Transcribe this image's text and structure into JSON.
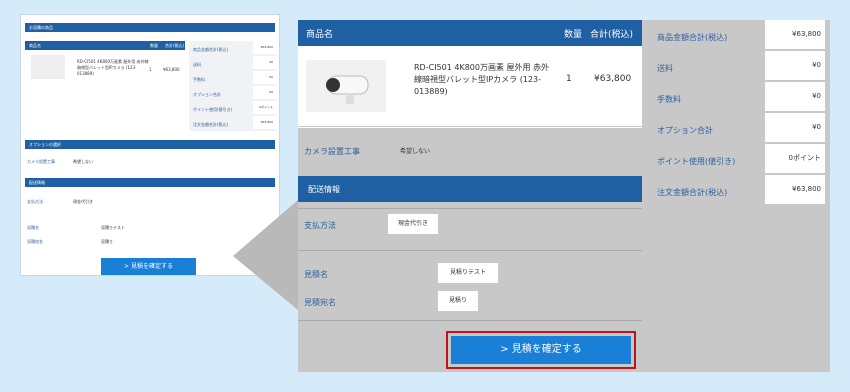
{
  "mini": {
    "title": "お見積の商品",
    "col_product": "商品名",
    "col_qty": "数量",
    "col_total": "合計(税込)",
    "product_name": "RD-CI501 4K800万画素 屋外用 赤外線暗視型バレット型IPカメラ (123-013889)",
    "qty": "1",
    "price": "¥63,800",
    "summary": [
      {
        "label": "商品金額合計(税込)",
        "value": "¥63,800"
      },
      {
        "label": "送料",
        "value": "¥0"
      },
      {
        "label": "手数料",
        "value": "¥0"
      },
      {
        "label": "オプション合計",
        "value": "¥0"
      },
      {
        "label": "ポイント使用(値引き)",
        "value": "0ポイント"
      },
      {
        "label": "注文金額合計(税込)",
        "value": "¥63,800"
      }
    ],
    "options_title": "オプションの選択",
    "camera_label": "カメラ設置工事",
    "camera_value": "希望しない",
    "delivery_title": "配送情報",
    "payment_label": "支払方法",
    "payment_value": "現金代引き",
    "estimate_name_label": "見積名",
    "estimate_name_value": "見積りテスト",
    "estimate_to_label": "見積宛名",
    "estimate_to_value": "見積り",
    "confirm": "> 見積を確定する"
  },
  "main": {
    "col_product": "商品名",
    "col_qty": "数量",
    "col_total": "合計(税込)",
    "product_name": "RD-CI501 4K800万画素 屋外用 赤外線暗視型バレット型IPカメラ (123-013889)",
    "qty": "1",
    "price": "¥63,800",
    "camera_label": "カメラ設置工事",
    "camera_value": "希望しない",
    "delivery_title": "配送情報",
    "payment_label": "支払方法",
    "payment_value": "現金代引き",
    "estimate_name_label": "見積名",
    "estimate_name_value": "見積りテスト",
    "estimate_to_label": "見積宛名",
    "estimate_to_value": "見積り",
    "confirm": "> 見積を確定する",
    "summary": [
      {
        "label": "商品金額合計(税込)",
        "value": "¥63,800"
      },
      {
        "label": "送料",
        "value": "¥0"
      },
      {
        "label": "手数料",
        "value": "¥0"
      },
      {
        "label": "オプション合計",
        "value": "¥0"
      },
      {
        "label": "ポイント使用(値引き)",
        "value": "0ポイント"
      },
      {
        "label": "注文金額合計(税込)",
        "value": "¥63,800"
      }
    ]
  },
  "colors": {
    "accent": "#1f5fa3",
    "button": "#1a7fd6",
    "highlight": "#c0141b",
    "background": "#d5ebf9"
  }
}
